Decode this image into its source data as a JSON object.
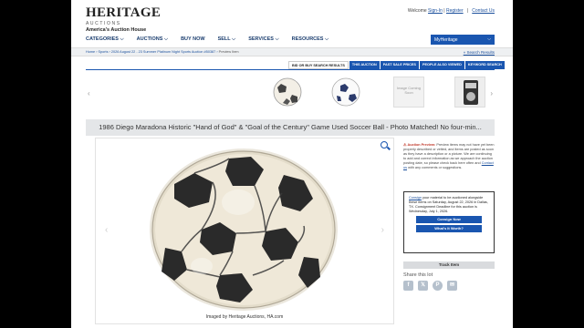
{
  "header": {
    "logo_main": "HERITAGE",
    "logo_sub": "AUCTIONS",
    "logo_tag": "America's Auction House",
    "welcome_prefix": "Welcome",
    "sign_in": "Sign-In",
    "separator": "|",
    "register": "Register",
    "contact": "Contact Us"
  },
  "nav": {
    "items": [
      "CATEGORIES ⌵",
      "AUCTIONS ⌵",
      "BUY NOW",
      "SELL ⌵",
      "SERVICES ⌵",
      "RESOURCES ⌵"
    ],
    "myheritage": "MyHeritage"
  },
  "breadcrumb": {
    "home": "Home",
    "sports": "Sports",
    "auction": "2026 August 22 - 23 Summer Platinum Night Sports Auction #50387",
    "current": "Preview Item",
    "search_results": "« Search Results"
  },
  "tabs": [
    "BID OR BUY SEARCH RESULTS",
    "THIS AUCTION",
    "PAST SALE PRICES",
    "PEOPLE ALSO VIEWED",
    "KEYWORD SEARCH"
  ],
  "thumbs": {
    "coming_soon": "Image Coming Soon"
  },
  "item": {
    "title": "1986 Diego Maradona Historic \"Hand of God\" & \"Goal of the Century\" Game Used Soccer Ball - Photo Matched! No four-min...",
    "image_credit": "Imaged by Heritage Auctions, HA.com"
  },
  "preview_notice": {
    "label": "Auction Preview:",
    "text": "Preview items may not have yet been properly described or vetted, and items are posted as soon as they have a description or a picture. We are continuing to add and correct information as we approach the auction posting date, so please check back here often and",
    "link": "Contact us",
    "tail": "with any comments or suggestions."
  },
  "consign": {
    "link": "Consign",
    "text": "your material to be auctioned alongside these items on Saturday, August 22, 2026 in Dallas, TX. Consignment Deadline for this auction is Wednesday, July 1, 2026.",
    "button": "Consign Now",
    "worth_button": "What's It Worth?"
  },
  "actions": {
    "track": "Track Item",
    "share": "Share this lot"
  },
  "social": {
    "icons": [
      "facebook-icon",
      "x-icon",
      "pinterest-icon",
      "email-icon"
    ],
    "glyphs": [
      "f",
      "𝕏",
      "P",
      "✉"
    ]
  }
}
